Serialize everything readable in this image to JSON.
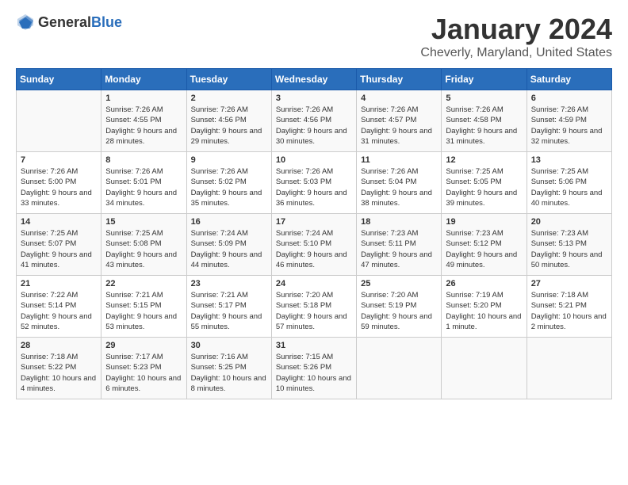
{
  "header": {
    "logo_general": "General",
    "logo_blue": "Blue",
    "month": "January 2024",
    "location": "Cheverly, Maryland, United States"
  },
  "days_of_week": [
    "Sunday",
    "Monday",
    "Tuesday",
    "Wednesday",
    "Thursday",
    "Friday",
    "Saturday"
  ],
  "weeks": [
    [
      {
        "day": "",
        "sunrise": "",
        "sunset": "",
        "daylight": ""
      },
      {
        "day": "1",
        "sunrise": "Sunrise: 7:26 AM",
        "sunset": "Sunset: 4:55 PM",
        "daylight": "Daylight: 9 hours and 28 minutes."
      },
      {
        "day": "2",
        "sunrise": "Sunrise: 7:26 AM",
        "sunset": "Sunset: 4:56 PM",
        "daylight": "Daylight: 9 hours and 29 minutes."
      },
      {
        "day": "3",
        "sunrise": "Sunrise: 7:26 AM",
        "sunset": "Sunset: 4:56 PM",
        "daylight": "Daylight: 9 hours and 30 minutes."
      },
      {
        "day": "4",
        "sunrise": "Sunrise: 7:26 AM",
        "sunset": "Sunset: 4:57 PM",
        "daylight": "Daylight: 9 hours and 31 minutes."
      },
      {
        "day": "5",
        "sunrise": "Sunrise: 7:26 AM",
        "sunset": "Sunset: 4:58 PM",
        "daylight": "Daylight: 9 hours and 31 minutes."
      },
      {
        "day": "6",
        "sunrise": "Sunrise: 7:26 AM",
        "sunset": "Sunset: 4:59 PM",
        "daylight": "Daylight: 9 hours and 32 minutes."
      }
    ],
    [
      {
        "day": "7",
        "sunrise": "Sunrise: 7:26 AM",
        "sunset": "Sunset: 5:00 PM",
        "daylight": "Daylight: 9 hours and 33 minutes."
      },
      {
        "day": "8",
        "sunrise": "Sunrise: 7:26 AM",
        "sunset": "Sunset: 5:01 PM",
        "daylight": "Daylight: 9 hours and 34 minutes."
      },
      {
        "day": "9",
        "sunrise": "Sunrise: 7:26 AM",
        "sunset": "Sunset: 5:02 PM",
        "daylight": "Daylight: 9 hours and 35 minutes."
      },
      {
        "day": "10",
        "sunrise": "Sunrise: 7:26 AM",
        "sunset": "Sunset: 5:03 PM",
        "daylight": "Daylight: 9 hours and 36 minutes."
      },
      {
        "day": "11",
        "sunrise": "Sunrise: 7:26 AM",
        "sunset": "Sunset: 5:04 PM",
        "daylight": "Daylight: 9 hours and 38 minutes."
      },
      {
        "day": "12",
        "sunrise": "Sunrise: 7:25 AM",
        "sunset": "Sunset: 5:05 PM",
        "daylight": "Daylight: 9 hours and 39 minutes."
      },
      {
        "day": "13",
        "sunrise": "Sunrise: 7:25 AM",
        "sunset": "Sunset: 5:06 PM",
        "daylight": "Daylight: 9 hours and 40 minutes."
      }
    ],
    [
      {
        "day": "14",
        "sunrise": "Sunrise: 7:25 AM",
        "sunset": "Sunset: 5:07 PM",
        "daylight": "Daylight: 9 hours and 41 minutes."
      },
      {
        "day": "15",
        "sunrise": "Sunrise: 7:25 AM",
        "sunset": "Sunset: 5:08 PM",
        "daylight": "Daylight: 9 hours and 43 minutes."
      },
      {
        "day": "16",
        "sunrise": "Sunrise: 7:24 AM",
        "sunset": "Sunset: 5:09 PM",
        "daylight": "Daylight: 9 hours and 44 minutes."
      },
      {
        "day": "17",
        "sunrise": "Sunrise: 7:24 AM",
        "sunset": "Sunset: 5:10 PM",
        "daylight": "Daylight: 9 hours and 46 minutes."
      },
      {
        "day": "18",
        "sunrise": "Sunrise: 7:23 AM",
        "sunset": "Sunset: 5:11 PM",
        "daylight": "Daylight: 9 hours and 47 minutes."
      },
      {
        "day": "19",
        "sunrise": "Sunrise: 7:23 AM",
        "sunset": "Sunset: 5:12 PM",
        "daylight": "Daylight: 9 hours and 49 minutes."
      },
      {
        "day": "20",
        "sunrise": "Sunrise: 7:23 AM",
        "sunset": "Sunset: 5:13 PM",
        "daylight": "Daylight: 9 hours and 50 minutes."
      }
    ],
    [
      {
        "day": "21",
        "sunrise": "Sunrise: 7:22 AM",
        "sunset": "Sunset: 5:14 PM",
        "daylight": "Daylight: 9 hours and 52 minutes."
      },
      {
        "day": "22",
        "sunrise": "Sunrise: 7:21 AM",
        "sunset": "Sunset: 5:15 PM",
        "daylight": "Daylight: 9 hours and 53 minutes."
      },
      {
        "day": "23",
        "sunrise": "Sunrise: 7:21 AM",
        "sunset": "Sunset: 5:17 PM",
        "daylight": "Daylight: 9 hours and 55 minutes."
      },
      {
        "day": "24",
        "sunrise": "Sunrise: 7:20 AM",
        "sunset": "Sunset: 5:18 PM",
        "daylight": "Daylight: 9 hours and 57 minutes."
      },
      {
        "day": "25",
        "sunrise": "Sunrise: 7:20 AM",
        "sunset": "Sunset: 5:19 PM",
        "daylight": "Daylight: 9 hours and 59 minutes."
      },
      {
        "day": "26",
        "sunrise": "Sunrise: 7:19 AM",
        "sunset": "Sunset: 5:20 PM",
        "daylight": "Daylight: 10 hours and 1 minute."
      },
      {
        "day": "27",
        "sunrise": "Sunrise: 7:18 AM",
        "sunset": "Sunset: 5:21 PM",
        "daylight": "Daylight: 10 hours and 2 minutes."
      }
    ],
    [
      {
        "day": "28",
        "sunrise": "Sunrise: 7:18 AM",
        "sunset": "Sunset: 5:22 PM",
        "daylight": "Daylight: 10 hours and 4 minutes."
      },
      {
        "day": "29",
        "sunrise": "Sunrise: 7:17 AM",
        "sunset": "Sunset: 5:23 PM",
        "daylight": "Daylight: 10 hours and 6 minutes."
      },
      {
        "day": "30",
        "sunrise": "Sunrise: 7:16 AM",
        "sunset": "Sunset: 5:25 PM",
        "daylight": "Daylight: 10 hours and 8 minutes."
      },
      {
        "day": "31",
        "sunrise": "Sunrise: 7:15 AM",
        "sunset": "Sunset: 5:26 PM",
        "daylight": "Daylight: 10 hours and 10 minutes."
      },
      {
        "day": "",
        "sunrise": "",
        "sunset": "",
        "daylight": ""
      },
      {
        "day": "",
        "sunrise": "",
        "sunset": "",
        "daylight": ""
      },
      {
        "day": "",
        "sunrise": "",
        "sunset": "",
        "daylight": ""
      }
    ]
  ]
}
